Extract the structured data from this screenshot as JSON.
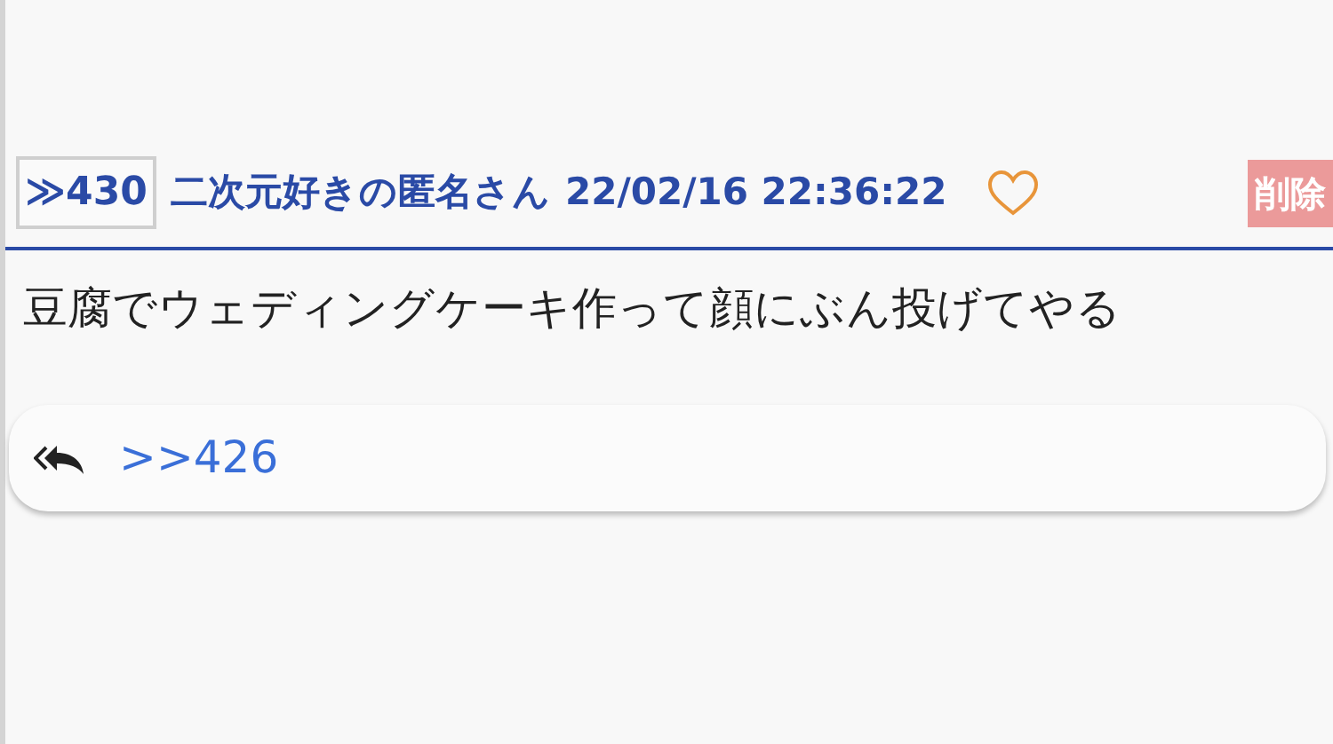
{
  "post": {
    "number": "≫430",
    "author": "二次元好きの匿名さん",
    "date": "22/02/16 22:36:22",
    "liked": false,
    "delete_label": "削除",
    "body": "豆腐でウェディングケーキ作って顔にぶん投げてやる",
    "replies": [
      {
        "label": ">>426"
      }
    ]
  }
}
